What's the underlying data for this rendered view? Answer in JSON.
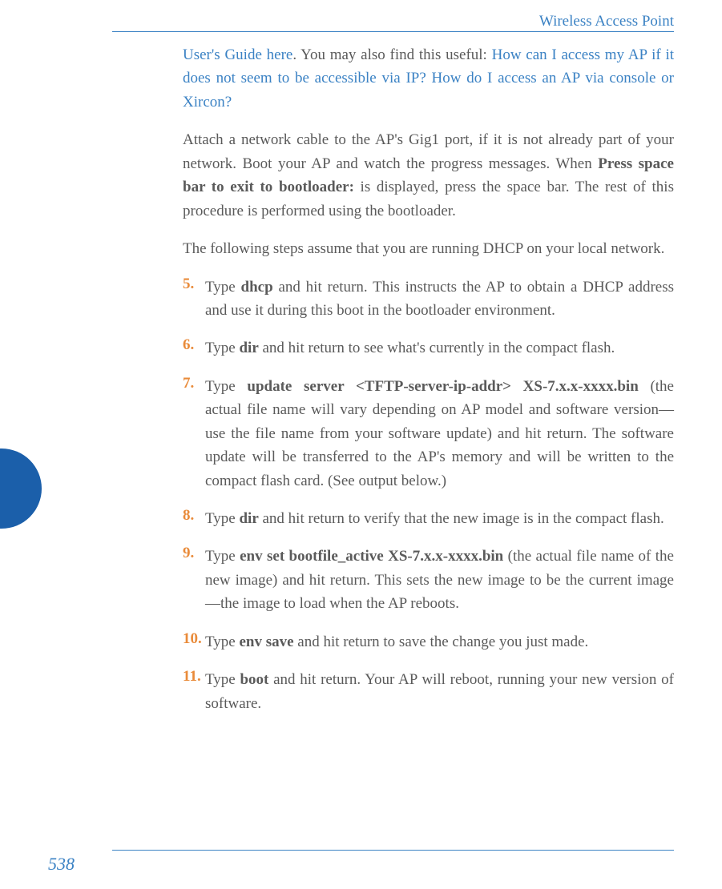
{
  "header": {
    "title": "Wireless Access Point"
  },
  "intro": {
    "link1": "User's Guide here",
    "afterLink1": ". You may also find this useful: ",
    "link2": "How can I access my AP if it does not seem to be accessible via IP? How do I access an AP via console or Xircon?"
  },
  "para2": {
    "pre": "Attach a network cable to the AP's Gig1 port, if it is not already part of your network. Boot your AP and watch the progress messages. When ",
    "bold": "Press space bar to exit to bootloader:",
    "post": " is displayed, press the space bar. The rest of this procedure is performed using the bootloader."
  },
  "para3": "The following steps assume that you are running DHCP on your local network.",
  "steps": {
    "s5": {
      "num": "5.",
      "pre": "Type ",
      "bold": "dhcp",
      "post": " and hit return. This instructs the AP to obtain a DHCP address and use it during this boot in the bootloader environment."
    },
    "s6": {
      "num": "6.",
      "pre": "Type ",
      "bold": "dir",
      "post": " and hit return to see what's currently in the compact flash."
    },
    "s7": {
      "num": "7.",
      "pre": "Type ",
      "bold": "update server <TFTP-server-ip-addr> XS-7.x.x-xxxx.bin",
      "post": " (the actual file name will vary depending on AP model and software version—use the file name from your software update) and hit return. The software update will be transferred to the AP's memory and will be written to the compact flash card. (See output below.)"
    },
    "s8": {
      "num": "8.",
      "pre": "Type ",
      "bold": "dir",
      "post": " and hit return to verify that the new image is in the compact flash."
    },
    "s9": {
      "num": "9.",
      "pre": "Type ",
      "bold": "env set bootfile_active XS-7.x.x-xxxx.bin",
      "post": " (the actual file name of the new image) and hit return. This sets the new image to be the current image—the image to load when the AP reboots."
    },
    "s10": {
      "num": "10.",
      "pre": "Type ",
      "bold": "env save",
      "post": " and hit return to save the change you just made."
    },
    "s11": {
      "num": "11.",
      "pre": "Type ",
      "bold": "boot",
      "post": " and hit return. Your AP will reboot, running your new version of software."
    }
  },
  "pageNumber": "538"
}
